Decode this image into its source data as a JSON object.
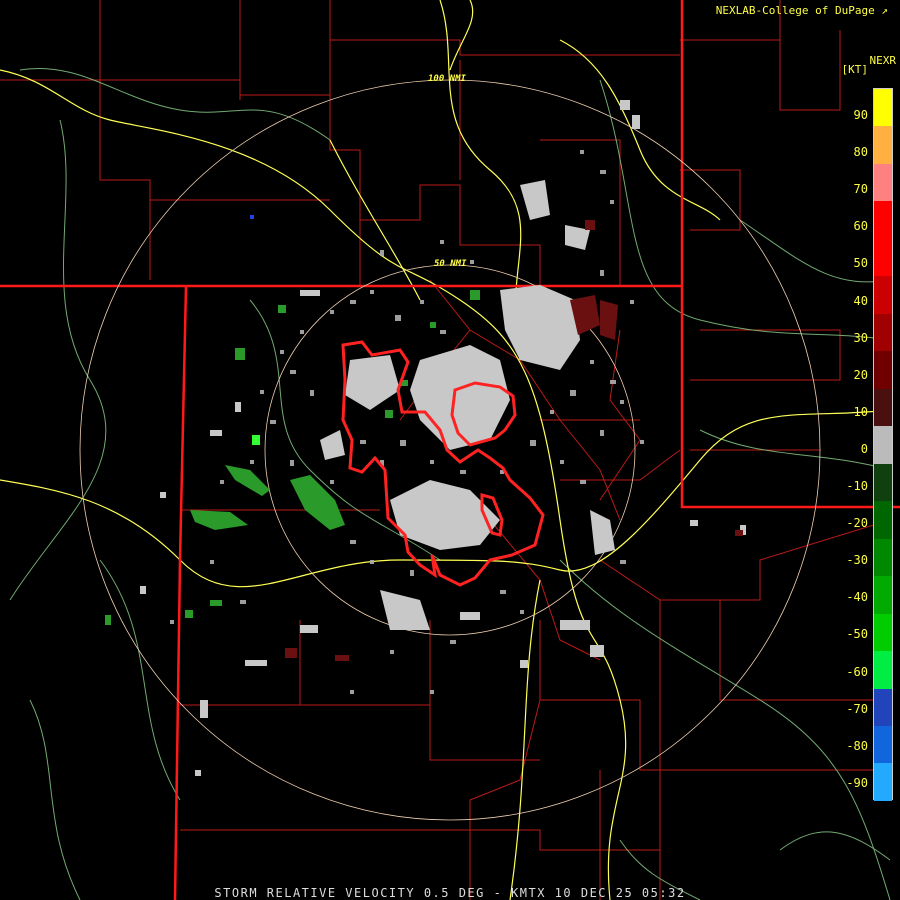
{
  "credit": "NEXLAB-College of DuPage",
  "product": "NEXR",
  "units": "[KT]",
  "rings": [
    {
      "label": "100 NMI"
    },
    {
      "label": "50 NMI"
    }
  ],
  "footer": "STORM RELATIVE VELOCITY 0.5 DEG - KMTX 10 DEC 25 05:32",
  "scale": {
    "ticks": [
      "90",
      "80",
      "70",
      "60",
      "50",
      "40",
      "30",
      "20",
      "10",
      "0",
      "-10",
      "-20",
      "-30",
      "-40",
      "-50",
      "-60",
      "-70",
      "-80",
      "-90"
    ],
    "colors": [
      "#ffff00",
      "#ffb040",
      "#ff8080",
      "#ff0000",
      "#ff0000",
      "#cc0000",
      "#a00000",
      "#700000",
      "#4a1010",
      "#bbbbbb",
      "#104010",
      "#006600",
      "#008800",
      "#00aa00",
      "#00cc00",
      "#00ee44",
      "#2244bb",
      "#1166dd",
      "#22aaff"
    ]
  },
  "colors": {
    "state_line": "#ff2222",
    "county_line": "#cc2222",
    "highway": "#ffff55",
    "river": "#8fd58f",
    "ring": "#f0d0b0",
    "warning": "#ff2222"
  }
}
